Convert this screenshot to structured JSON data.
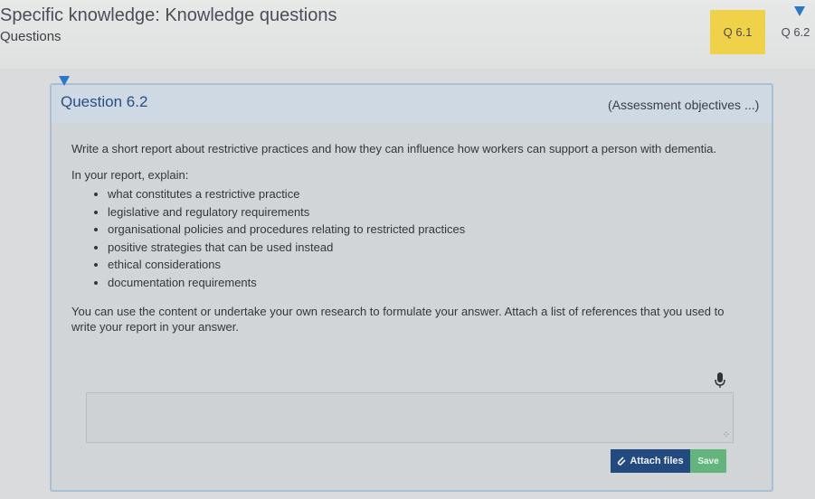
{
  "header": {
    "title": "Specific knowledge: Knowledge questions",
    "subtitle": "Questions"
  },
  "tabs": [
    {
      "label": "Q 6.1",
      "active": true
    },
    {
      "label": "Q 6.2",
      "active": false
    }
  ],
  "question": {
    "number": "Question 6.2",
    "assessment_link": "(Assessment objectives ...)",
    "intro": "Write a short report about restrictive practices and how they can influence how workers can support a person with dementia.",
    "explain_lead": "In your report, explain:",
    "items": [
      "what constitutes a restrictive practice",
      "legislative and regulatory requirements",
      "organisational policies and procedures relating to restricted practices",
      "positive strategies that can be used instead",
      "ethical considerations",
      "documentation requirements"
    ],
    "closing": "You can use the content or undertake your own research to formulate your answer. Attach a list of references that you used to write your report in your answer."
  },
  "answer": {
    "value": "",
    "placeholder": ""
  },
  "buttons": {
    "attach_label": "Attach files",
    "save_label": "Save"
  },
  "icons": {
    "mic": "microphone-icon",
    "attach": "paperclip-icon",
    "collapse": "triangle-down-icon"
  },
  "colors": {
    "active_tab": "#f0d14a",
    "accent_blue": "#2c78c6",
    "heading_blue": "#274f86",
    "attach_button": "#234a7f",
    "save_button": "#64b57d"
  }
}
